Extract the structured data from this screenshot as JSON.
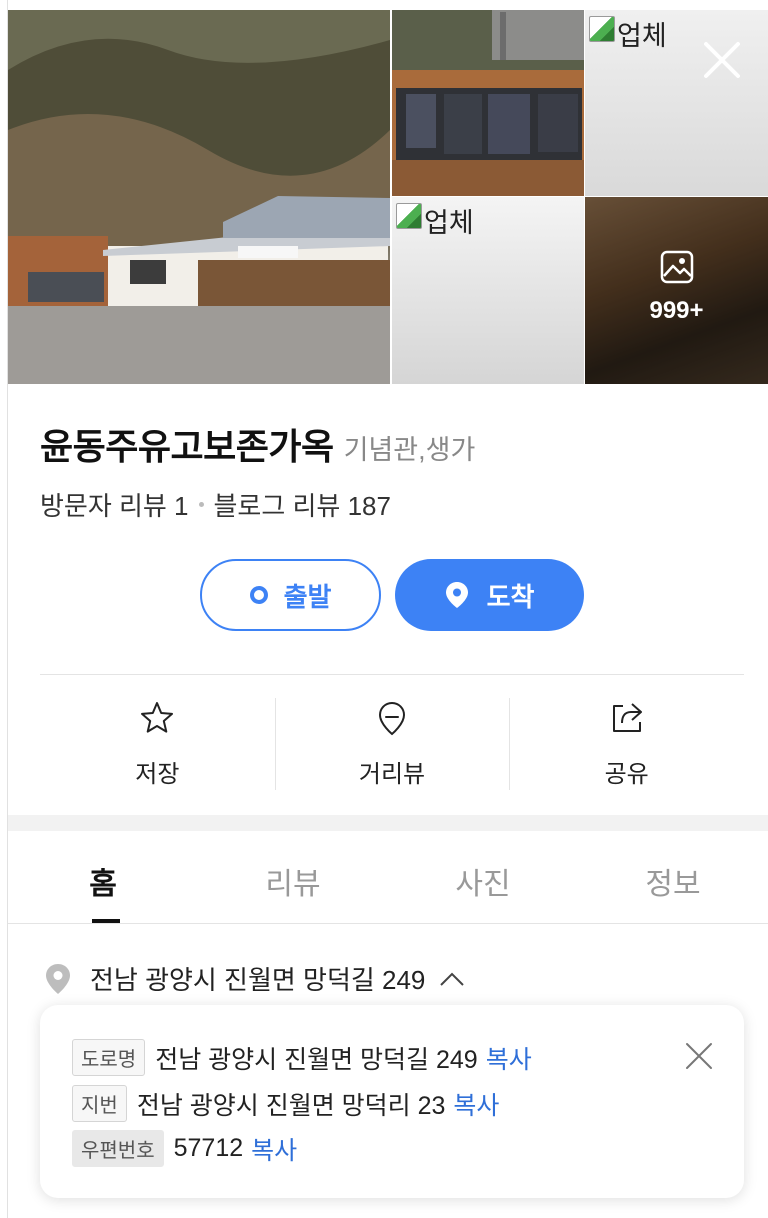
{
  "photos": {
    "broken_alt_top": "업체",
    "broken_alt_bottom": "업체",
    "more_count": "999+"
  },
  "place": {
    "name": "윤동주유고보존가옥",
    "category": "기념관,생가",
    "visitor_reviews": "방문자 리뷰 1",
    "blog_reviews": "블로그 리뷰 187"
  },
  "route": {
    "start_label": "출발",
    "arrive_label": "도착"
  },
  "actions": [
    {
      "label": "저장",
      "icon": "star-icon"
    },
    {
      "label": "거리뷰",
      "icon": "map-pin-outline-icon"
    },
    {
      "label": "공유",
      "icon": "share-icon"
    }
  ],
  "tabs": [
    {
      "label": "홈",
      "active": true
    },
    {
      "label": "리뷰",
      "active": false
    },
    {
      "label": "사진",
      "active": false
    },
    {
      "label": "정보",
      "active": false
    }
  ],
  "address": {
    "summary": "전남 광양시 진월면 망덕길 249",
    "road_badge": "도로명",
    "road": "전남 광양시 진월면 망덕길 249",
    "lot_badge": "지번",
    "lot": "전남 광양시 진월면 망덕리 23",
    "postal_badge": "우편번호",
    "postal": "57712",
    "copy_label": "복사"
  },
  "colors": {
    "accent": "#3d82f5",
    "link": "#2f6fd8"
  }
}
